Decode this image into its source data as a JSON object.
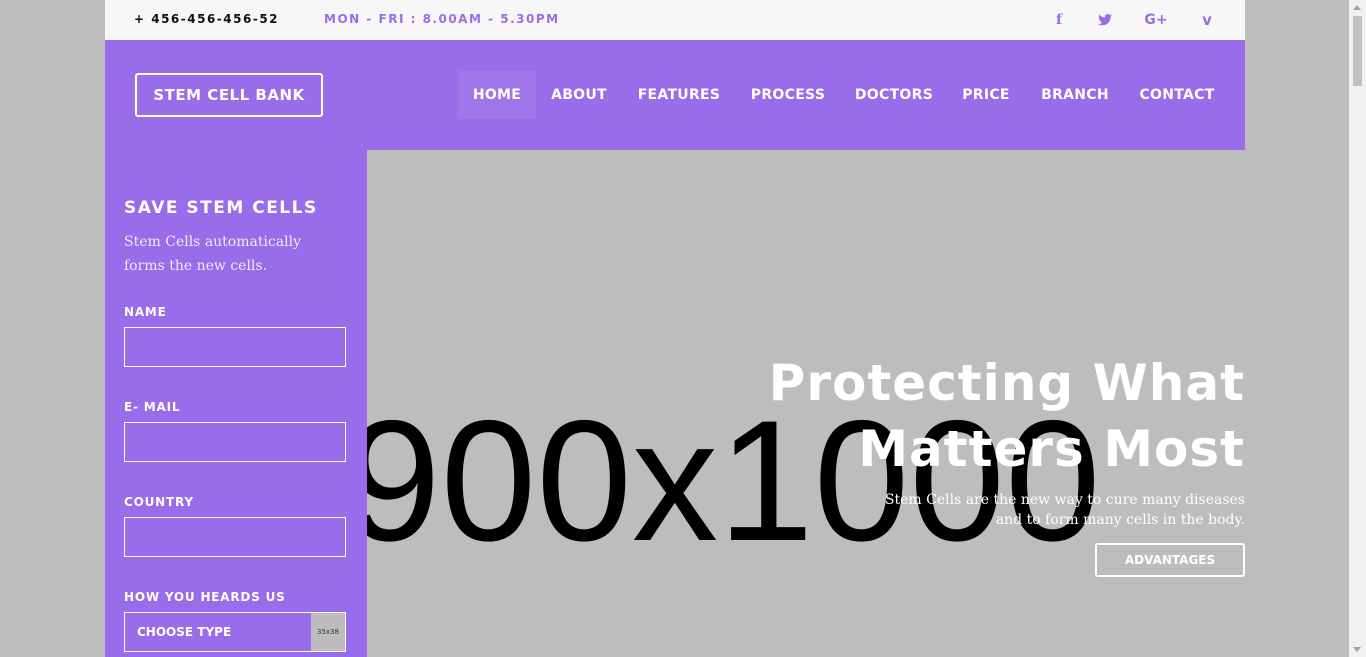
{
  "topbar": {
    "phone": "+ 456-456-456-52",
    "hours": "MON - FRI : 8.00AM - 5.30PM",
    "social": [
      {
        "icon": "facebook-icon",
        "glyph": "f"
      },
      {
        "icon": "twitter-icon",
        "glyph": "🐦"
      },
      {
        "icon": "google-plus-icon",
        "glyph": "G+"
      },
      {
        "icon": "vimeo-icon",
        "glyph": "v"
      }
    ]
  },
  "header": {
    "logo": "STEM CELL BANK",
    "nav": [
      "HOME",
      "ABOUT",
      "FEATURES",
      "PROCESS",
      "DOCTORS",
      "PRICE",
      "BRANCH",
      "CONTACT"
    ],
    "active": "HOME"
  },
  "sidebar": {
    "title": "SAVE STEM CELLS",
    "description": "Stem Cells automatically forms the new cells.",
    "name_label": "NAME",
    "email_label": "E- MAIL",
    "country_label": "COUNTRY",
    "heard_label": "HOW YOU HEARDS US",
    "select_value": "CHOOSE TYPE",
    "select_button": "35x38"
  },
  "hero": {
    "placeholder": "900x1000",
    "title_line1": "Protecting What",
    "title_line2": "Matters Most",
    "subtitle_line1": "Stem Cells are the new way to cure many diseases",
    "subtitle_line2": "and to form many cells in the body.",
    "button": "ADVANTAGES"
  },
  "colors": {
    "accent": "#996ce9",
    "background": "#bdbdbd",
    "topbar": "#f7f7f7"
  }
}
